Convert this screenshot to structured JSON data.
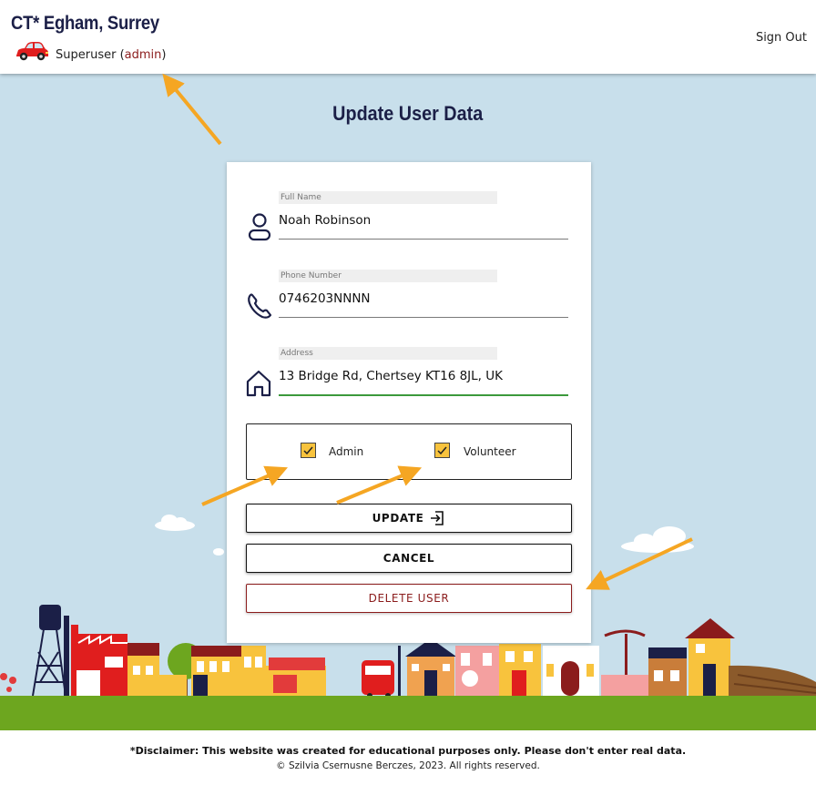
{
  "header": {
    "brand": "CT* Egham, Surrey",
    "role_prefix": "Superuser (",
    "username": "admin",
    "role_suffix": ")",
    "sign_out": "Sign Out",
    "car_icon": "car-icon"
  },
  "page": {
    "title": "Update User Data"
  },
  "form": {
    "full_name": {
      "label": "Full Name",
      "value": "Noah Robinson",
      "icon": "person-icon"
    },
    "phone": {
      "label": "Phone Number",
      "value": "0746203NNNN",
      "icon": "phone-icon"
    },
    "address": {
      "label": "Address",
      "value": "13 Bridge Rd, Chertsey KT16 8JL, UK",
      "icon": "house-icon"
    },
    "roles": [
      {
        "label": "Admin",
        "checked": true
      },
      {
        "label": "Volunteer",
        "checked": true
      }
    ]
  },
  "buttons": {
    "update": "UPDATE",
    "cancel": "CANCEL",
    "delete": "DELETE USER"
  },
  "footer": {
    "disclaimer": "*Disclaimer: This website was created for educational purposes only. Please don't enter real data.",
    "copyright": "© Szilvia Csernusne Berczes, 2023. All rights reserved."
  },
  "colors": {
    "navy": "#1b1f47",
    "sky": "#c8dfeb",
    "grass": "#6da61f",
    "checkbox": "#f8c33d",
    "danger": "#8b1c1c",
    "arrow": "#f5a623"
  }
}
